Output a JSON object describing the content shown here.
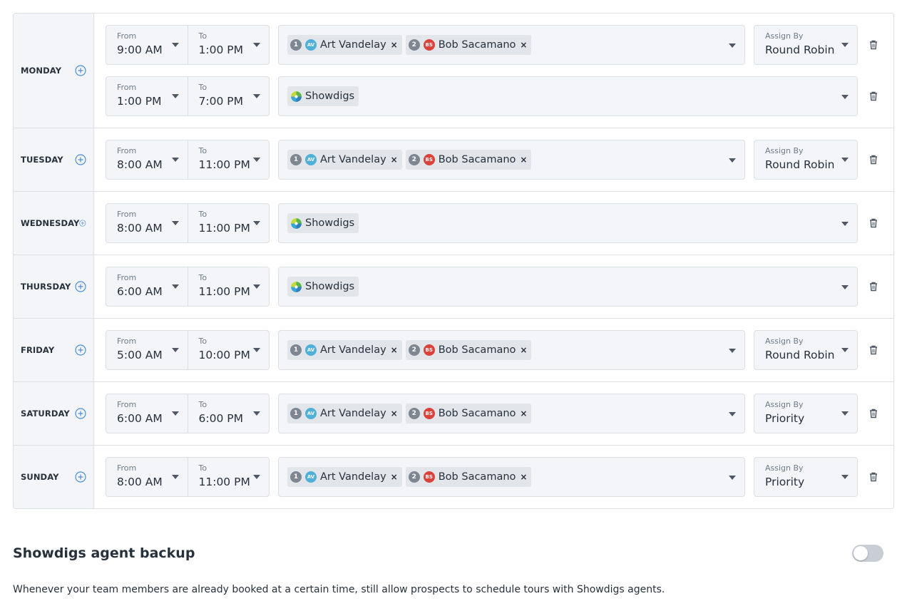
{
  "labels": {
    "from": "From",
    "to": "To",
    "assign_by": "Assign By",
    "remove": "×"
  },
  "agents": {
    "art": {
      "order": "1",
      "initials": "AV",
      "name": "Art Vandelay"
    },
    "bob": {
      "order": "2",
      "initials": "BS",
      "name": "Bob Sacamano"
    },
    "showdigs": {
      "name": "Showdigs"
    }
  },
  "days": [
    {
      "name": "MONDAY",
      "slots": [
        {
          "from": "9:00 AM",
          "to": "1:00 PM",
          "assign_by": "Round Robin"
        },
        {
          "from": "1:00 PM",
          "to": "7:00 PM"
        }
      ]
    },
    {
      "name": "TUESDAY",
      "slots": [
        {
          "from": "8:00 AM",
          "to": "11:00 PM",
          "assign_by": "Round Robin"
        }
      ]
    },
    {
      "name": "WEDNESDAY",
      "slots": [
        {
          "from": "8:00 AM",
          "to": "11:00 PM"
        }
      ]
    },
    {
      "name": "THURSDAY",
      "slots": [
        {
          "from": "6:00 AM",
          "to": "11:00 PM"
        }
      ]
    },
    {
      "name": "FRIDAY",
      "slots": [
        {
          "from": "5:00 AM",
          "to": "10:00 PM",
          "assign_by": "Round Robin"
        }
      ]
    },
    {
      "name": "SATURDAY",
      "slots": [
        {
          "from": "6:00 AM",
          "to": "6:00 PM",
          "assign_by": "Priority"
        }
      ]
    },
    {
      "name": "SUNDAY",
      "slots": [
        {
          "from": "8:00 AM",
          "to": "11:00 PM",
          "assign_by": "Priority"
        }
      ]
    }
  ],
  "backup": {
    "title": "Showdigs agent backup",
    "description": "Whenever your team members are already booked at a certain time, still allow prospects to schedule tours with Showdigs agents.",
    "enabled": false
  },
  "colors": {
    "accent": "#4a8fe0",
    "panel_bg": "#f4f5f8",
    "border": "#dcdfe4",
    "chip_bg": "#e2e5ea",
    "avatar_av": "#4fb0d8",
    "avatar_bs": "#d8433c",
    "toggle_off": "#c8ced6"
  },
  "icons": {
    "add": "plus-circle-icon",
    "caret": "caret-down-icon",
    "delete": "trash-icon",
    "remove": "close-icon",
    "brand": "showdigs-logo-icon"
  }
}
